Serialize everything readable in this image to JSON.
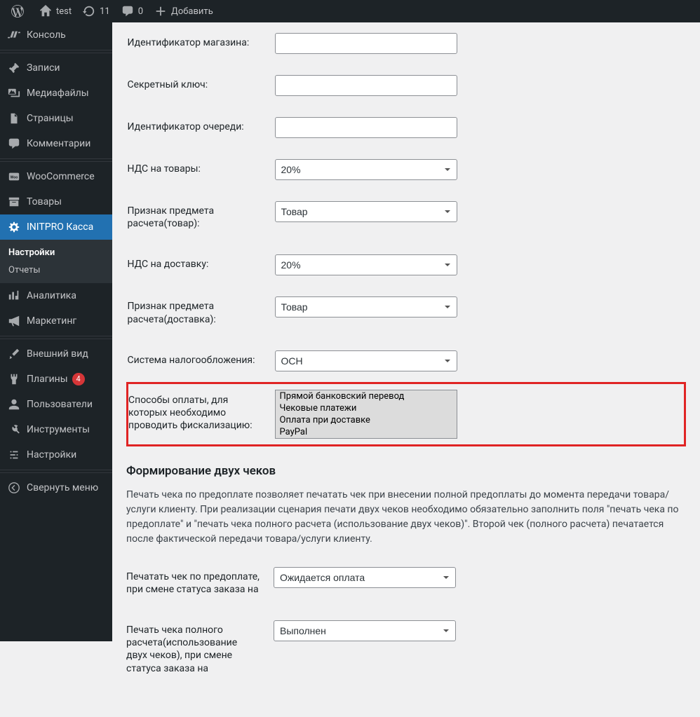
{
  "adminbar": {
    "site_name": "test",
    "updates_count": "11",
    "comments_count": "0",
    "add_new": "Добавить"
  },
  "sidebar": {
    "items": [
      {
        "label": "Консоль"
      },
      {
        "label": "Записи"
      },
      {
        "label": "Медиафайлы"
      },
      {
        "label": "Страницы"
      },
      {
        "label": "Комментарии"
      },
      {
        "label": "WooCommerce"
      },
      {
        "label": "Товары"
      },
      {
        "label": "INITPRO Касса"
      },
      {
        "label": "Аналитика"
      },
      {
        "label": "Маркетинг"
      },
      {
        "label": "Внешний вид"
      },
      {
        "label": "Плагины",
        "badge": "4"
      },
      {
        "label": "Пользователи"
      },
      {
        "label": "Инструменты"
      },
      {
        "label": "Настройки"
      },
      {
        "label": "Свернуть меню"
      }
    ],
    "submenu": [
      {
        "label": "Настройки",
        "current": true
      },
      {
        "label": "Отчеты"
      }
    ]
  },
  "form": {
    "shop_id_label": "Идентификатор магазина:",
    "shop_id_value": "",
    "secret_key_label": "Секретный ключ:",
    "secret_key_value": "",
    "queue_id_label": "Идентификатор очереди:",
    "queue_id_value": "",
    "vat_goods_label": "НДС на товары:",
    "vat_goods_value": "20%",
    "subject_goods_label": "Признак предмета расчета(товар):",
    "subject_goods_value": "Товар",
    "vat_delivery_label": "НДС на доставку:",
    "vat_delivery_value": "20%",
    "subject_delivery_label": "Признак предмета расчета(доставка):",
    "subject_delivery_value": "Товар",
    "tax_system_label": "Система налогообложения:",
    "tax_system_value": "ОСН",
    "payment_methods_label": "Способы оплаты, для которых необходимо проводить фискализацию:",
    "payment_methods_options": [
      "Прямой банковский перевод",
      "Чековые платежи",
      "Оплата при доставке",
      "PayPal"
    ],
    "two_checks_heading": "Формирование двух чеков",
    "two_checks_desc": "Печать чека по предоплате позволяет печатать чек при внесении полной предоплаты до момента передачи товара/услуги клиенту. При реализации сценария печати двух чеков необходимо обязательно заполнить поля \"печать чека по предоплате\" и \"печать чека полного расчета (использование двух чеков)\". Второй чек (полного расчета) печатается после фактической передачи товара/услуги клиенту.",
    "prepay_status_label": "Печатать чек по предоплате, при смене статуса заказа на",
    "prepay_status_value": "Ожидается оплата",
    "full_status_label": "Печать чека полного расчета(использование двух чеков), при смене статуса заказа на",
    "full_status_value": "Выполнен"
  }
}
